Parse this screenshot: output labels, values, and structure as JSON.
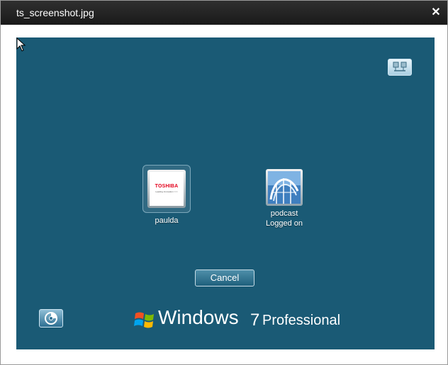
{
  "window": {
    "title": "ts_screenshot.jpg",
    "close_symbol": "✕"
  },
  "screen": {
    "background_color": "#1a5a75",
    "network_icon": "network-icon",
    "ease_of_access_icon": "ease-of-access-icon",
    "users": [
      {
        "name": "paulda",
        "picture_brand": "TOSHIBA",
        "picture_tagline": "Leading Innovation >>>",
        "status": ""
      },
      {
        "name": "podcast",
        "status": "Logged on"
      }
    ],
    "cancel_label": "Cancel",
    "branding": {
      "product": "Windows",
      "version": "7",
      "edition": "Professional"
    }
  }
}
